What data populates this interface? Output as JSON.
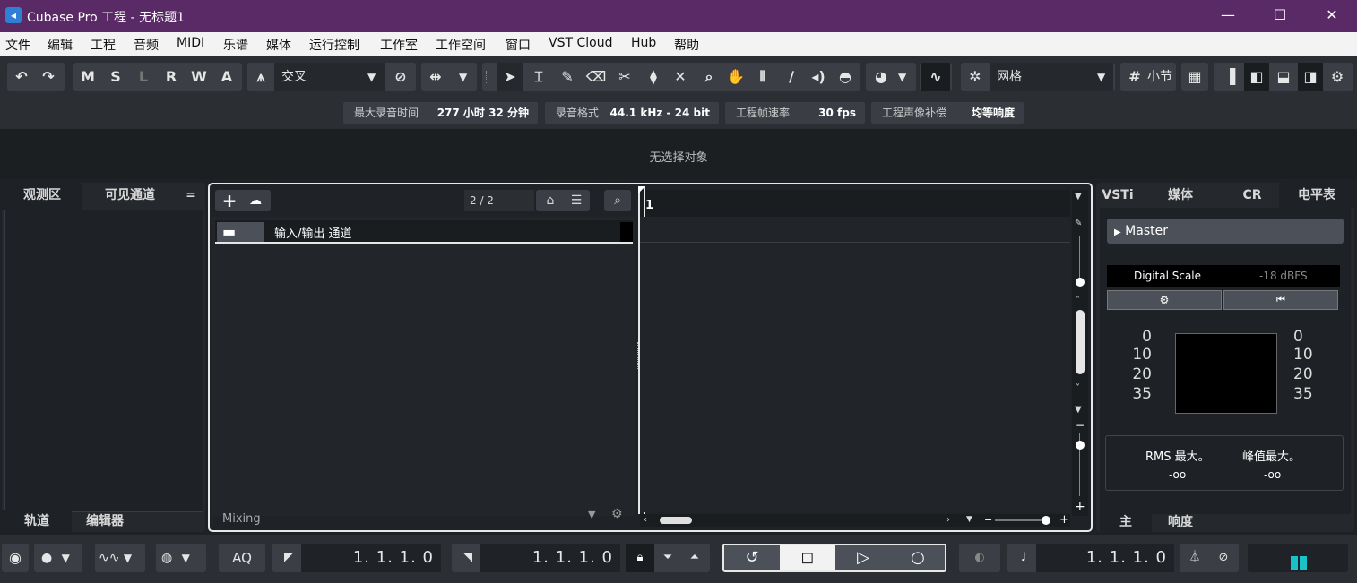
{
  "window": {
    "title": "Cubase Pro 工程 - 无标题1",
    "logo_icon": "cubase-logo-icon",
    "controls": [
      "minimize-icon",
      "maximize-icon",
      "close-icon"
    ],
    "minimize_glyph": "—",
    "maximize_glyph": "☐",
    "close_glyph": "✕"
  },
  "menu": [
    "文件",
    "编辑",
    "工程",
    "音频",
    "MIDI",
    "乐谱",
    "媒体",
    "运行控制",
    "工作室",
    "工作空间",
    "窗口",
    "VST Cloud",
    "Hub",
    "帮助"
  ],
  "toolbar": {
    "undo_icon": "undo-icon",
    "redo_icon": "redo-icon",
    "mute_label": "M",
    "solo_label": "S",
    "listen_label": "L",
    "read_label": "R",
    "write_label": "W",
    "auto_label": "A",
    "crossfade_mode": "交叉",
    "snap_type": "网格",
    "grid_prefix": "#",
    "grid_label": "小节",
    "tools": [
      "select-tool-icon",
      "range-tool-icon",
      "draw-tool-icon",
      "erase-tool-icon",
      "split-tool-icon",
      "glue-tool-icon",
      "mute-tool-icon",
      "zoom-tool-icon",
      "hand-tool-icon",
      "comp-tool-icon",
      "line-tool-icon",
      "play-tool-icon",
      "color-tool-icon"
    ]
  },
  "info": [
    {
      "label": "最大录音时间",
      "value": "277 小时 32 分钟"
    },
    {
      "label": "录音格式",
      "value": "44.1 kHz - 24 bit"
    },
    {
      "label": "工程帧速率",
      "value": "30 fps"
    },
    {
      "label": "工程声像补偿",
      "value": "均等响度"
    }
  ],
  "inspector": {
    "empty_text": "无选择对象"
  },
  "left_zone": {
    "tabs": [
      "观测区",
      "可见通道"
    ],
    "menu_glyph": "=",
    "bottom_tabs": [
      "轨道",
      "编辑器"
    ]
  },
  "project": {
    "add_track_glyph": "+",
    "track_count": "2 / 2",
    "tracks": [
      {
        "name": "输入/输出 通道",
        "type": "folder"
      }
    ],
    "footer_label": "Mixing",
    "ruler_start": "1"
  },
  "right_zone": {
    "tabs": [
      "VSTi",
      "媒体",
      "CR",
      "电平表"
    ],
    "channel": "Master",
    "scale_label": "Digital Scale",
    "scale_value": "-18 dBFS",
    "meter_ticks": [
      "0",
      "10",
      "20",
      "35"
    ],
    "rms_label": "RMS 最大。",
    "rms_value": "-oo",
    "peak_label": "峰值最大。",
    "peak_value": "-oo",
    "bottom_tabs": [
      "主",
      "响度"
    ]
  },
  "transport": {
    "aq_label": "AQ",
    "left_locator": "1. 1. 1.   0",
    "right_locator": "1. 1. 1.   0",
    "primary_position": "1. 1. 1.   0",
    "buttons": [
      "cycle-icon",
      "stop-icon",
      "play-icon",
      "record-icon"
    ]
  },
  "colors": {
    "titlebar": "#5a2a66",
    "accent_meter": "#19c2c9",
    "panel": "#25282c"
  }
}
